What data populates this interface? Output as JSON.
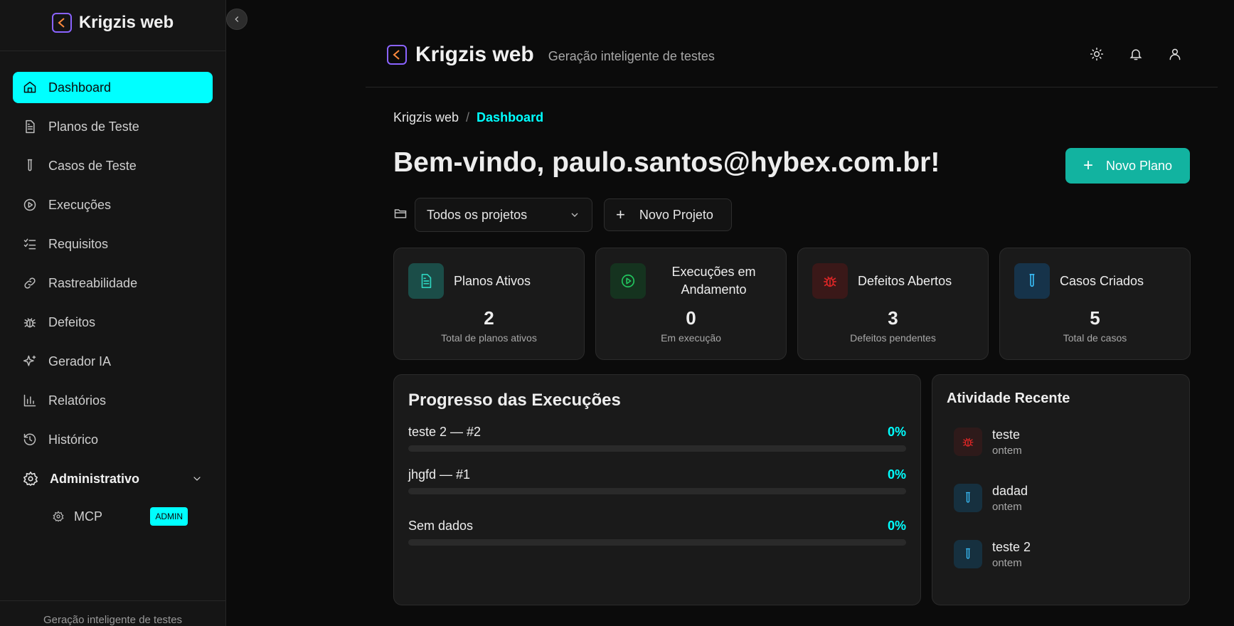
{
  "app": {
    "name": "Krigzis web",
    "tagline": "Geração inteligente de testes"
  },
  "sidebar": {
    "items": [
      {
        "label": "Dashboard",
        "icon": "home-icon"
      },
      {
        "label": "Planos de Teste",
        "icon": "file-text-icon"
      },
      {
        "label": "Casos de Teste",
        "icon": "test-tube-icon"
      },
      {
        "label": "Execuções",
        "icon": "play-circle-icon"
      },
      {
        "label": "Requisitos",
        "icon": "list-checks-icon"
      },
      {
        "label": "Rastreabilidade",
        "icon": "link-icon"
      },
      {
        "label": "Defeitos",
        "icon": "bug-icon"
      },
      {
        "label": "Gerador IA",
        "icon": "sparkles-icon"
      },
      {
        "label": "Relatórios",
        "icon": "bar-chart-icon"
      },
      {
        "label": "Histórico",
        "icon": "history-icon"
      }
    ],
    "admin": {
      "label": "Administrativo",
      "sub_label": "MCP",
      "badge": "ADMIN"
    },
    "footer": "Geração inteligente de testes"
  },
  "breadcrumb": {
    "root": "Krigzis web",
    "separator": "/",
    "current": "Dashboard"
  },
  "welcome": "Bem-vindo, paulo.santos@hybex.com.br!",
  "actions": {
    "new_plan": "Novo Plano",
    "new_project": "Novo Projeto",
    "plus": "+"
  },
  "project_select": {
    "value": "Todos os projetos"
  },
  "stats": [
    {
      "label": "Planos Ativos",
      "value": "2",
      "sub": "Total de planos ativos",
      "icon": "file-text-icon",
      "color": "#2dd4bf"
    },
    {
      "label": "Execuções em Andamento",
      "value": "0",
      "sub": "Em execução",
      "icon": "play-circle-icon",
      "color": "#22c55e"
    },
    {
      "label": "Defeitos Abertos",
      "value": "3",
      "sub": "Defeitos pendentes",
      "icon": "bug-icon",
      "color": "#dc2626"
    },
    {
      "label": "Casos Criados",
      "value": "5",
      "sub": "Total de casos",
      "icon": "test-tube-icon",
      "color": "#38bdf8"
    }
  ],
  "progress": {
    "title": "Progresso das Execuções",
    "rows": [
      {
        "name": "teste 2 — #2",
        "pct": "0%",
        "fraction": 0
      },
      {
        "name": "jhgfd — #1",
        "pct": "0%",
        "fraction": 0
      },
      {
        "name": "Sem dados",
        "pct": "0%",
        "fraction": 0
      }
    ]
  },
  "activity": {
    "title": "Atividade Recente",
    "items": [
      {
        "name": "teste",
        "time": "ontem",
        "icon": "bug-icon"
      },
      {
        "name": "dadad",
        "time": "ontem",
        "icon": "test-tube-icon"
      },
      {
        "name": "teste 2",
        "time": "ontem",
        "icon": "test-tube-icon"
      }
    ]
  },
  "colors": {
    "accent": "#00ffff",
    "primary_button": "#12b3a0",
    "logo": "#8a63ff"
  }
}
